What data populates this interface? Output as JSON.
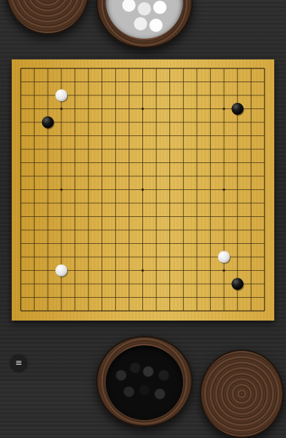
{
  "board": {
    "size": 19,
    "star_points": [
      [
        3,
        3
      ],
      [
        9,
        3
      ],
      [
        15,
        3
      ],
      [
        3,
        9
      ],
      [
        9,
        9
      ],
      [
        15,
        9
      ],
      [
        3,
        15
      ],
      [
        9,
        15
      ],
      [
        15,
        15
      ]
    ],
    "line_color": "#3a2a10",
    "wood_color": "#dcb24a"
  },
  "stones": [
    {
      "color": "white",
      "col": 3,
      "row": 2
    },
    {
      "color": "black",
      "col": 2,
      "row": 4
    },
    {
      "color": "black",
      "col": 16,
      "row": 3
    },
    {
      "color": "white",
      "col": 15,
      "row": 14
    },
    {
      "color": "white",
      "col": 3,
      "row": 15
    },
    {
      "color": "black",
      "col": 16,
      "row": 16
    }
  ],
  "bowls": {
    "top_left": {
      "content": "lid"
    },
    "top_center": {
      "content": "white-stones"
    },
    "bottom_center": {
      "content": "black-stones"
    },
    "bottom_right": {
      "content": "lid"
    }
  },
  "menu": {
    "icon": "hamburger-menu-icon",
    "glyph": "≡"
  }
}
